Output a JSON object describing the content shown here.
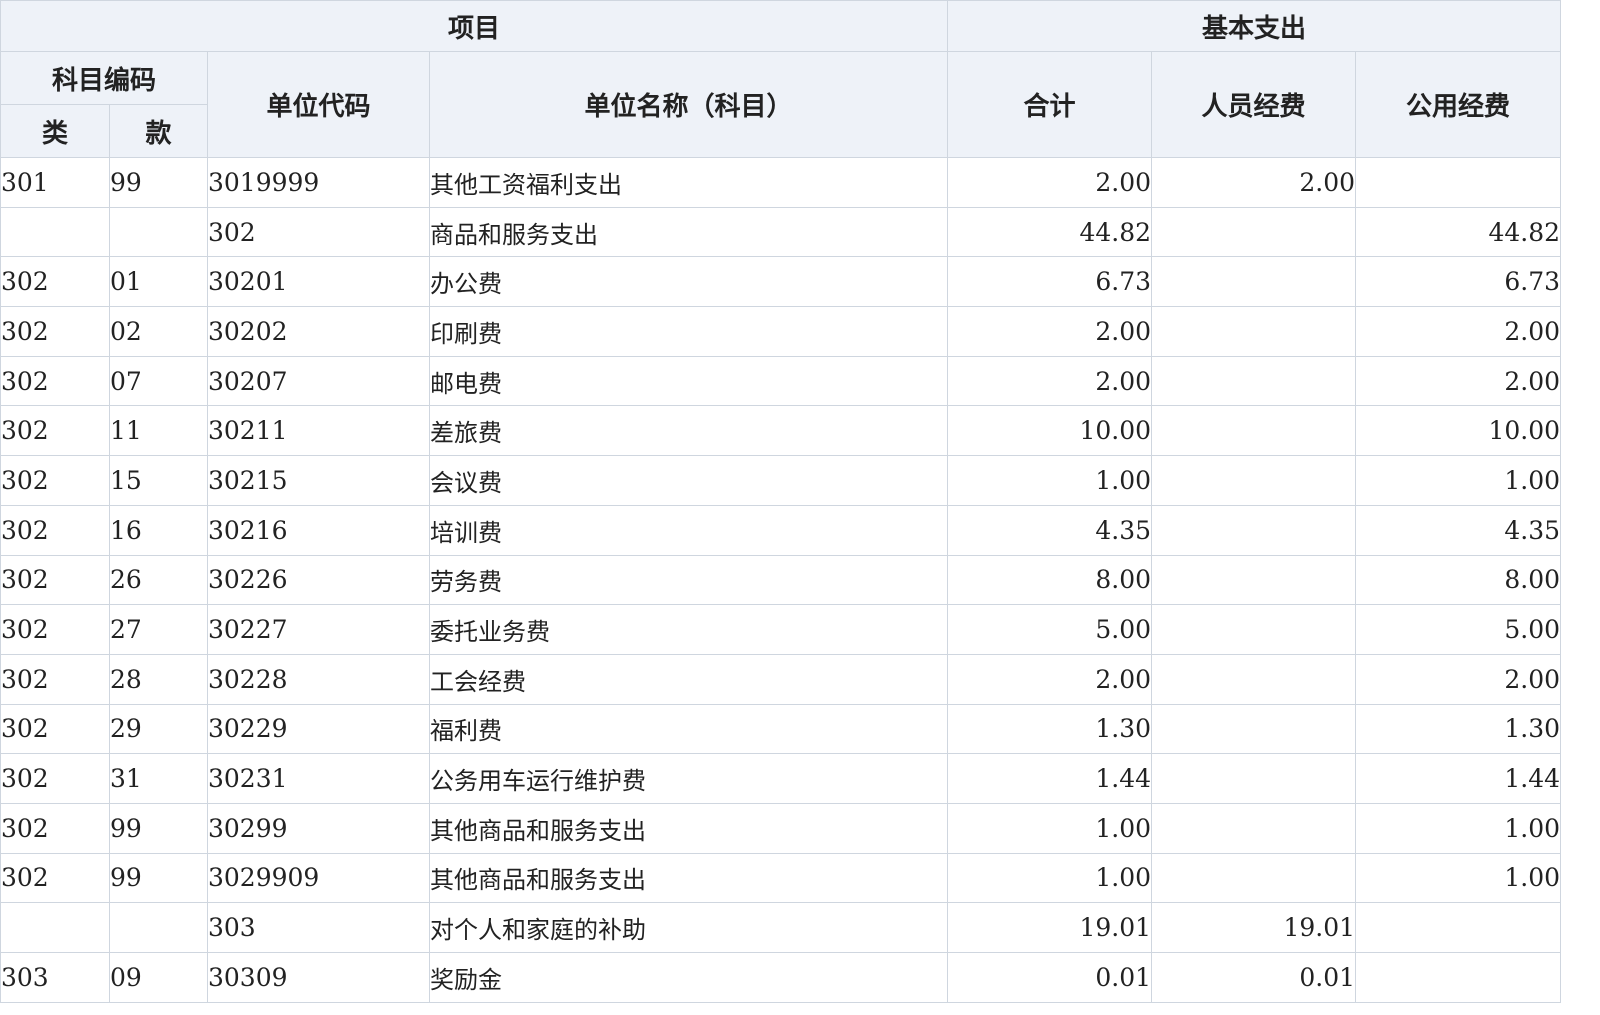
{
  "header": {
    "project": "项目",
    "basic_expense": "基本支出",
    "subject_code": "科目编码",
    "class": "类",
    "item": "款",
    "unit_code": "单位代码",
    "unit_name": "单位名称（科目）",
    "total": "合计",
    "personnel": "人员经费",
    "public": "公用经费"
  },
  "rows": [
    {
      "class": "301",
      "item": "99",
      "code": "3019999",
      "name": "其他工资福利支出",
      "total": "2.00",
      "personnel": "2.00",
      "public": ""
    },
    {
      "class": "",
      "item": "",
      "code": "302",
      "name": "商品和服务支出",
      "total": "44.82",
      "personnel": "",
      "public": "44.82"
    },
    {
      "class": "302",
      "item": "01",
      "code": "30201",
      "name": "办公费",
      "total": "6.73",
      "personnel": "",
      "public": "6.73"
    },
    {
      "class": "302",
      "item": "02",
      "code": "30202",
      "name": "印刷费",
      "total": "2.00",
      "personnel": "",
      "public": "2.00"
    },
    {
      "class": "302",
      "item": "07",
      "code": "30207",
      "name": "邮电费",
      "total": "2.00",
      "personnel": "",
      "public": "2.00"
    },
    {
      "class": "302",
      "item": "11",
      "code": "30211",
      "name": "差旅费",
      "total": "10.00",
      "personnel": "",
      "public": "10.00"
    },
    {
      "class": "302",
      "item": "15",
      "code": "30215",
      "name": "会议费",
      "total": "1.00",
      "personnel": "",
      "public": "1.00"
    },
    {
      "class": "302",
      "item": "16",
      "code": "30216",
      "name": "培训费",
      "total": "4.35",
      "personnel": "",
      "public": "4.35"
    },
    {
      "class": "302",
      "item": "26",
      "code": "30226",
      "name": "劳务费",
      "total": "8.00",
      "personnel": "",
      "public": "8.00"
    },
    {
      "class": "302",
      "item": "27",
      "code": "30227",
      "name": "委托业务费",
      "total": "5.00",
      "personnel": "",
      "public": "5.00"
    },
    {
      "class": "302",
      "item": "28",
      "code": "30228",
      "name": "工会经费",
      "total": "2.00",
      "personnel": "",
      "public": "2.00"
    },
    {
      "class": "302",
      "item": "29",
      "code": "30229",
      "name": "福利费",
      "total": "1.30",
      "personnel": "",
      "public": "1.30"
    },
    {
      "class": "302",
      "item": "31",
      "code": "30231",
      "name": "公务用车运行维护费",
      "total": "1.44",
      "personnel": "",
      "public": "1.44"
    },
    {
      "class": "302",
      "item": "99",
      "code": "30299",
      "name": "其他商品和服务支出",
      "total": "1.00",
      "personnel": "",
      "public": "1.00"
    },
    {
      "class": "302",
      "item": "99",
      "code": "3029909",
      "name": "其他商品和服务支出",
      "total": "1.00",
      "personnel": "",
      "public": "1.00"
    },
    {
      "class": "",
      "item": "",
      "code": "303",
      "name": "对个人和家庭的补助",
      "total": "19.01",
      "personnel": "19.01",
      "public": ""
    },
    {
      "class": "303",
      "item": "09",
      "code": "30309",
      "name": "奖励金",
      "total": "0.01",
      "personnel": "0.01",
      "public": ""
    }
  ]
}
